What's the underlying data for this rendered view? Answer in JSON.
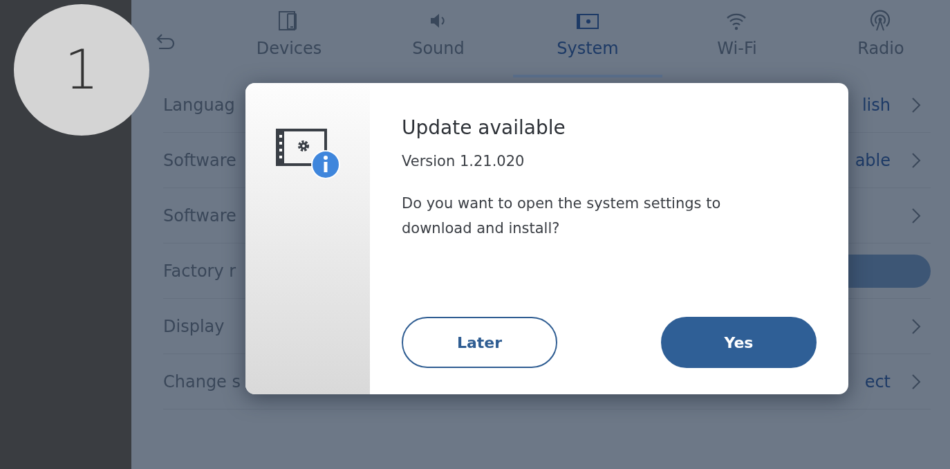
{
  "step_number": "1",
  "tabs": [
    {
      "label": "Devices",
      "kind": "devices",
      "selected": false
    },
    {
      "label": "Sound",
      "kind": "sound",
      "selected": false
    },
    {
      "label": "System",
      "kind": "system",
      "selected": true
    },
    {
      "label": "Wi-Fi",
      "kind": "wifi",
      "selected": false
    },
    {
      "label": "Radio",
      "kind": "radio",
      "selected": false
    }
  ],
  "settings_rows": [
    {
      "label": "Languag",
      "value": "lish",
      "kind": "chevron"
    },
    {
      "label": "Software",
      "value": "able",
      "kind": "chevron"
    },
    {
      "label": "Software",
      "kind": "chevron"
    },
    {
      "label": "Factory r",
      "kind": "button"
    },
    {
      "label": "Display",
      "kind": "chevron"
    },
    {
      "label": "Change s",
      "value": "ect",
      "kind": "chevron"
    }
  ],
  "dialog": {
    "title": "Update available",
    "version": "Version 1.21.020",
    "message": "Do you want to open the system settings to download and install?",
    "buttons": [
      {
        "label": "Later",
        "kind": "secondary"
      },
      {
        "label": "Yes",
        "kind": "primary"
      }
    ]
  }
}
